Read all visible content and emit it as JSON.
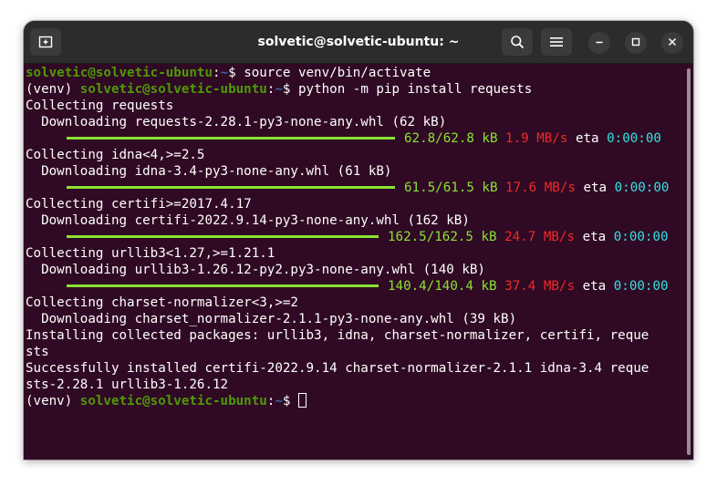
{
  "window": {
    "title": "solvetic@solvetic-ubuntu: ~"
  },
  "icons": {
    "new_tab": "new-tab-icon",
    "search": "search-icon",
    "menu": "hamburger-menu-icon",
    "minimize": "minimize-icon",
    "maximize": "maximize-icon",
    "close": "close-icon"
  },
  "colors": {
    "terminal_bg": "#300a24",
    "titlebar_bg": "#2c2c2c",
    "prompt_user": "#4e9a06",
    "prompt_path": "#3465a4",
    "progress_green": "#8ae234",
    "speed_red": "#ef2929",
    "eta_cyan": "#34e2e2"
  },
  "terminal": {
    "prompt": {
      "user_host": "solvetic@solvetic-ubuntu",
      "sep": ":",
      "path": "~",
      "symbol": "$",
      "venv": "(venv) "
    },
    "commands": [
      "source venv/bin/activate",
      "python -m pip install requests"
    ],
    "lines": [
      "Collecting requests",
      "  Downloading requests-2.28.1-py3-none-any.whl (62 kB)",
      "Collecting idna<4,>=2.5",
      "  Downloading idna-3.4-py3-none-any.whl (61 kB)",
      "Collecting certifi>=2017.4.17",
      "  Downloading certifi-2022.9.14-py3-none-any.whl (162 kB)",
      "Collecting urllib3<1.27,>=1.21.1",
      "  Downloading urllib3-1.26.12-py2.py3-none-any.whl (140 kB)",
      "Collecting charset-normalizer<3,>=2",
      "  Downloading charset_normalizer-2.1.1-py3-none-any.whl (39 kB)",
      "Installing collected packages: urllib3, idna, charset-normalizer, certifi, reque",
      "sts",
      "Successfully installed certifi-2022.9.14 charset-normalizer-2.1.1 idna-3.4 reque",
      "sts-2.28.1 urllib3-1.26.12"
    ],
    "progress": [
      {
        "size": "62.8/62.8 kB",
        "speed": "1.9 MB/s",
        "eta_label": "eta",
        "eta": "0:00:00"
      },
      {
        "size": "61.5/61.5 kB",
        "speed": "17.6 MB/s",
        "eta_label": "eta",
        "eta": "0:00:00"
      },
      {
        "size": "162.5/162.5 kB",
        "speed": "24.7 MB/s",
        "eta_label": "eta",
        "eta": "0:00:00"
      },
      {
        "size": "140.4/140.4 kB",
        "speed": "37.4 MB/s",
        "eta_label": "eta",
        "eta": "0:00:00"
      }
    ]
  }
}
